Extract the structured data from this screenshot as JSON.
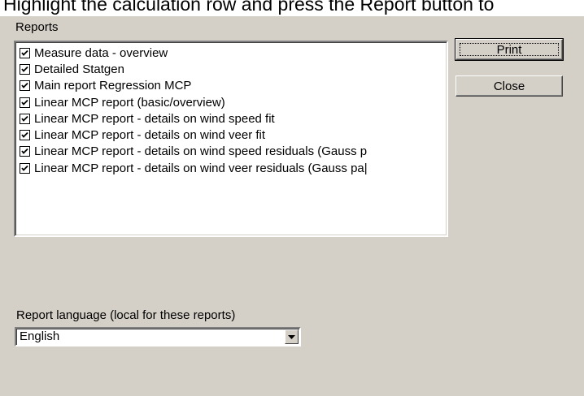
{
  "caption": "Highlight the calculation row and press the Report button to",
  "dialog": {
    "group_label": "Reports",
    "reports": [
      {
        "label": "Measure data - overview",
        "checked": true
      },
      {
        "label": "Detailed Statgen",
        "checked": true
      },
      {
        "label": "Main report Regression MCP",
        "checked": true
      },
      {
        "label": "Linear MCP report (basic/overview)",
        "checked": true
      },
      {
        "label": "Linear MCP report - details on wind speed fit",
        "checked": true
      },
      {
        "label": "Linear MCP report - details on wind veer fit",
        "checked": true
      },
      {
        "label": "Linear MCP report - details on wind speed residuals (Gauss p",
        "checked": true
      },
      {
        "label": "Linear MCP report - details on wind veer residuals (Gauss pa|",
        "checked": true
      }
    ],
    "print_label": "Print",
    "close_label": "Close",
    "language_label": "Report language (local for these reports)",
    "language_value": "English",
    "icons": {
      "checkbox": "check-mark-icon",
      "dropdown": "chevron-down-icon"
    }
  }
}
